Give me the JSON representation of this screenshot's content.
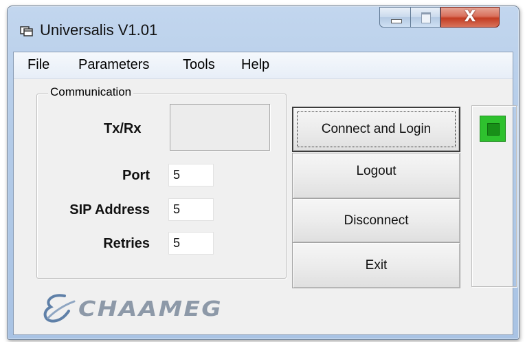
{
  "window": {
    "title": "Universalis V1.01",
    "controls": {
      "minimize": "minimize-icon",
      "maximize": "maximize-icon",
      "close": "close-icon",
      "close_glyph": "X"
    }
  },
  "menu": {
    "items": [
      {
        "label": "File"
      },
      {
        "label": "Parameters"
      },
      {
        "label": "Tools"
      },
      {
        "label": "Help"
      }
    ]
  },
  "communication": {
    "title": "Communication",
    "txrx_label": "Tx/Rx",
    "fields": [
      {
        "label": "Port",
        "value": "5"
      },
      {
        "label": "SIP Address",
        "value": "5"
      },
      {
        "label": "Retries",
        "value": "5"
      }
    ]
  },
  "actions": {
    "connect_label": "Connect and Login",
    "logout_label": "Logout",
    "disconnect_label": "Disconnect",
    "exit_label": "Exit"
  },
  "status": {
    "led_color": "#2ec12e",
    "state": "connected-indicator"
  },
  "logo": {
    "text": "CHAAMEG"
  },
  "colors": {
    "title_bar": "#b3cbe8",
    "close_button": "#c33d23",
    "client_background": "#f0f0f0"
  }
}
